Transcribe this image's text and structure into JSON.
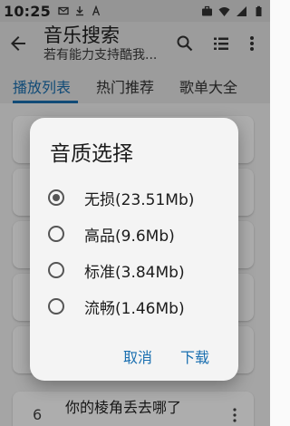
{
  "status_bar": {
    "time": "10:25",
    "notification_icons": [
      "mail-icon",
      "download-icon",
      "text-icon"
    ],
    "right_icons": [
      "briefcase-icon",
      "wifi-icon",
      "signal-icon",
      "battery-icon"
    ]
  },
  "app_bar": {
    "title": "音乐搜索",
    "subtitle": "若有能力支持酷我...",
    "icons": [
      "back-arrow-icon",
      "search-icon",
      "playlist-icon",
      "more-vert-icon"
    ]
  },
  "tabs": [
    {
      "label": "播放列表",
      "active": true
    },
    {
      "label": "热门推荐",
      "active": false
    },
    {
      "label": "歌单大全",
      "active": false
    }
  ],
  "list": {
    "items": [
      {
        "num": "",
        "title": ""
      },
      {
        "num": "",
        "title": ""
      },
      {
        "num": "",
        "title": ""
      },
      {
        "num": "",
        "title": ""
      },
      {
        "num": "",
        "title": ""
      },
      {
        "num": "6",
        "title": "你的棱角丢去哪了"
      }
    ]
  },
  "dialog": {
    "title": "音质选择",
    "options": [
      {
        "label": "无损(23.51Mb)",
        "selected": true
      },
      {
        "label": "高品(9.6Mb)",
        "selected": false
      },
      {
        "label": "标准(3.84Mb)",
        "selected": false
      },
      {
        "label": "流畅(1.46Mb)",
        "selected": false
      }
    ],
    "cancel_label": "取消",
    "confirm_label": "下载"
  },
  "colors": {
    "accent": "#1a6fb0",
    "app_bar_bg": "#e6e6e6",
    "dialog_bg": "#f4f4f4"
  }
}
